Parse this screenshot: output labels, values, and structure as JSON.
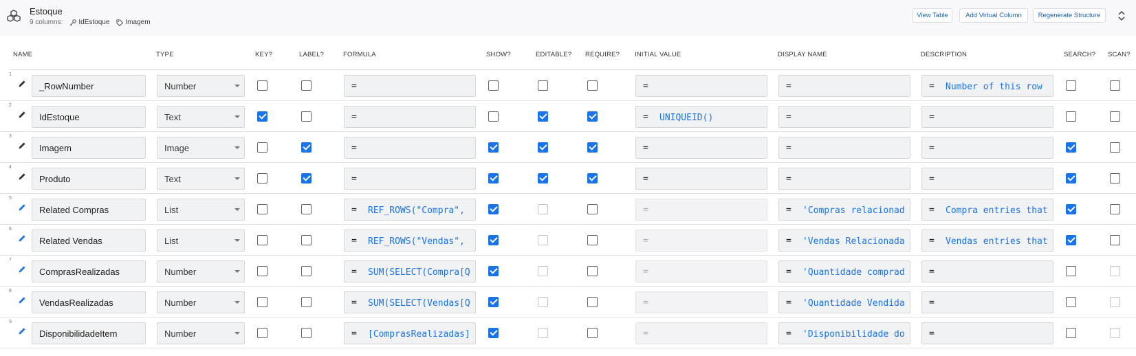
{
  "table": {
    "title": "Estoque",
    "columns_count": "9 columns:",
    "key_column": "IdEstoque",
    "label_column": "Imagem"
  },
  "actions": {
    "view_table": "View Table",
    "add_virtual_column": "Add Virtual Column",
    "regenerate_structure": "Regenerate Structure"
  },
  "headers": {
    "name": "NAME",
    "type": "TYPE",
    "key": "KEY?",
    "label": "LABEL?",
    "formula": "FORMULA",
    "show": "SHOW?",
    "editable": "EDITABLE?",
    "require": "REQUIRE?",
    "initial_value": "INITIAL VALUE",
    "display_name": "DISPLAY NAME",
    "description": "DESCRIPTION",
    "search": "SEARCH?",
    "scan": "SCAN?"
  },
  "colors": {
    "accent": "#1a73e8",
    "virtual_pencil": "#1a73e8",
    "physical_pencil": "#333333"
  },
  "rows": [
    {
      "num": "1",
      "virtual": false,
      "name": "_RowNumber",
      "type": "Number",
      "key": false,
      "label": false,
      "formula_eq": "=",
      "formula": "",
      "show": false,
      "editable": false,
      "editable_disabled": false,
      "require": false,
      "initial_eq": "=",
      "initial": "",
      "initial_disabled": false,
      "display_eq": "=",
      "display": "",
      "desc_eq": "=",
      "desc": "Number of this row",
      "search": false,
      "scan": false,
      "scan_disabled": false
    },
    {
      "num": "2",
      "virtual": false,
      "name": "IdEstoque",
      "type": "Text",
      "key": true,
      "label": false,
      "formula_eq": "=",
      "formula": "",
      "show": false,
      "editable": true,
      "editable_disabled": false,
      "require": true,
      "initial_eq": "=",
      "initial": "UNIQUEID()",
      "initial_disabled": false,
      "display_eq": "=",
      "display": "",
      "desc_eq": "=",
      "desc": "",
      "search": false,
      "scan": false,
      "scan_disabled": false
    },
    {
      "num": "3",
      "virtual": false,
      "name": "Imagem",
      "type": "Image",
      "key": false,
      "label": true,
      "formula_eq": "=",
      "formula": "",
      "show": true,
      "editable": true,
      "editable_disabled": false,
      "require": true,
      "initial_eq": "=",
      "initial": "",
      "initial_disabled": false,
      "display_eq": "=",
      "display": "",
      "desc_eq": "=",
      "desc": "",
      "search": true,
      "scan": false,
      "scan_disabled": false
    },
    {
      "num": "4",
      "virtual": false,
      "name": "Produto",
      "type": "Text",
      "key": false,
      "label": true,
      "formula_eq": "=",
      "formula": "",
      "show": true,
      "editable": true,
      "editable_disabled": false,
      "require": true,
      "initial_eq": "=",
      "initial": "",
      "initial_disabled": false,
      "display_eq": "=",
      "display": "",
      "desc_eq": "=",
      "desc": "",
      "search": true,
      "scan": false,
      "scan_disabled": false
    },
    {
      "num": "5",
      "virtual": true,
      "name": "Related Compras",
      "type": "List",
      "key": false,
      "label": false,
      "formula_eq": "=",
      "formula": "REF_ROWS(\"Compra\",",
      "show": true,
      "editable": false,
      "editable_disabled": true,
      "require": false,
      "initial_eq": "=",
      "initial": "",
      "initial_disabled": true,
      "display_eq": "=",
      "display": "'Compras relacionad",
      "desc_eq": "=",
      "desc": "Compra entries that",
      "search": true,
      "scan": false,
      "scan_disabled": false
    },
    {
      "num": "6",
      "virtual": true,
      "name": "Related Vendas",
      "type": "List",
      "key": false,
      "label": false,
      "formula_eq": "=",
      "formula": "REF_ROWS(\"Vendas\",",
      "show": true,
      "editable": false,
      "editable_disabled": true,
      "require": false,
      "initial_eq": "=",
      "initial": "",
      "initial_disabled": true,
      "display_eq": "=",
      "display": "'Vendas Relacionada",
      "desc_eq": "=",
      "desc": "Vendas entries that",
      "search": true,
      "scan": false,
      "scan_disabled": false
    },
    {
      "num": "7",
      "virtual": true,
      "name": "ComprasRealizadas",
      "type": "Number",
      "key": false,
      "label": false,
      "formula_eq": "=",
      "formula": "SUM(SELECT(Compra[Q",
      "show": true,
      "editable": false,
      "editable_disabled": true,
      "require": false,
      "initial_eq": "=",
      "initial": "",
      "initial_disabled": true,
      "display_eq": "=",
      "display": "'Quantidade comprad",
      "desc_eq": "=",
      "desc": "",
      "search": false,
      "scan": false,
      "scan_disabled": true
    },
    {
      "num": "8",
      "virtual": true,
      "name": "VendasRealizadas",
      "type": "Number",
      "key": false,
      "label": false,
      "formula_eq": "=",
      "formula": "SUM(SELECT(Vendas[Q",
      "show": true,
      "editable": false,
      "editable_disabled": true,
      "require": false,
      "initial_eq": "=",
      "initial": "",
      "initial_disabled": true,
      "display_eq": "=",
      "display": "'Quantidade Vendida",
      "desc_eq": "=",
      "desc": "",
      "search": false,
      "scan": false,
      "scan_disabled": true
    },
    {
      "num": "9",
      "virtual": true,
      "name": "DisponibilidadeItem",
      "type": "Number",
      "key": false,
      "label": false,
      "formula_eq": "=",
      "formula": "[ComprasRealizadas]",
      "show": true,
      "editable": false,
      "editable_disabled": true,
      "require": false,
      "initial_eq": "=",
      "initial": "",
      "initial_disabled": true,
      "display_eq": "=",
      "display": "'Disponibilidade do",
      "desc_eq": "=",
      "desc": "",
      "search": false,
      "scan": false,
      "scan_disabled": true
    }
  ]
}
